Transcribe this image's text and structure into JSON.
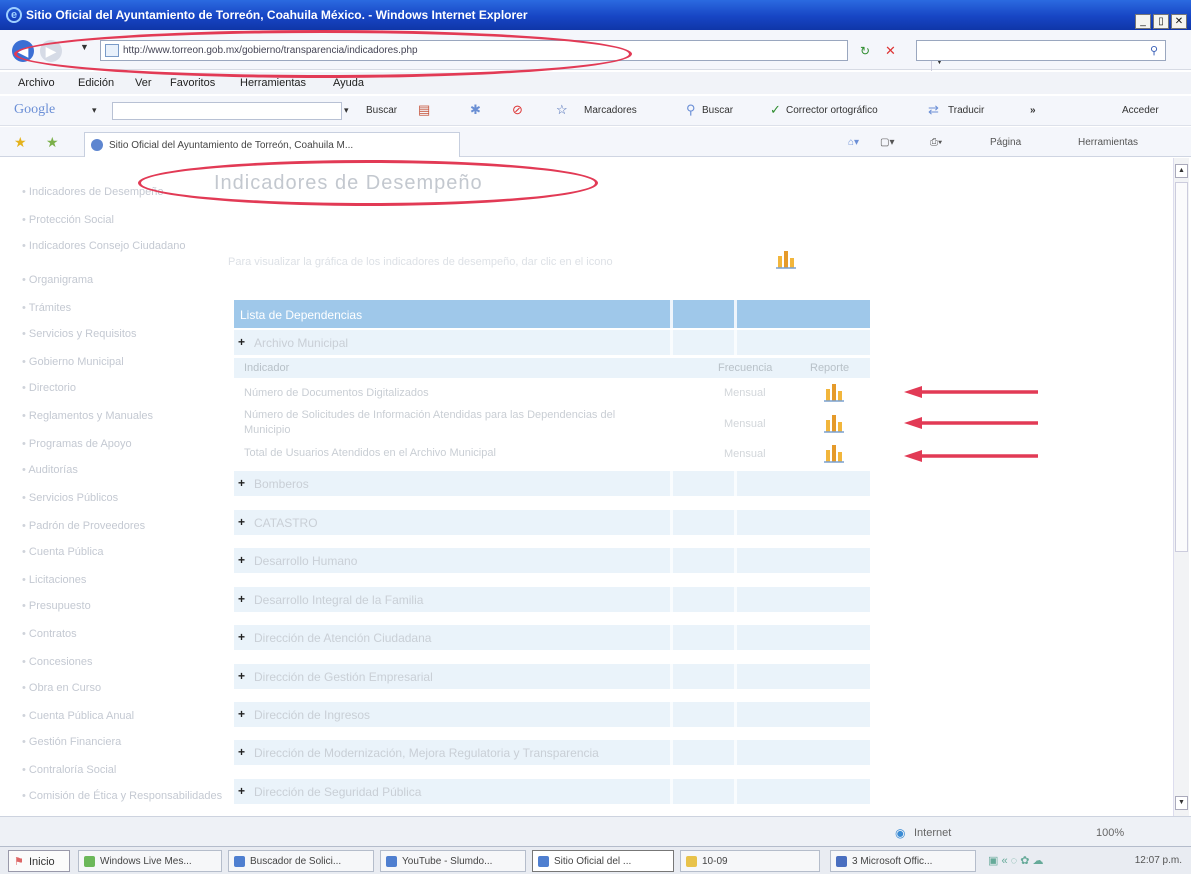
{
  "window": {
    "title": "Sitio Oficial del Ayuntamiento de Torreón, Coahuila México. - Windows Internet Explorer",
    "controls": [
      "_",
      "▯",
      "✕"
    ]
  },
  "address": {
    "url": "http://www.torreon.gob.mx/gobierno/transparencia/indicadores.php"
  },
  "menu": [
    "Archivo",
    "Edición",
    "Ver",
    "Favoritos",
    "Herramientas",
    "Ayuda"
  ],
  "google_toolbar": {
    "logo": "Google",
    "buscar": "Buscar",
    "marcadores": "Marcadores",
    "buscar2": "Buscar",
    "corrector": "Corrector ortográfico",
    "traducir": "Traducir",
    "more": "»",
    "acceder": "Acceder"
  },
  "tab": {
    "title": "Sitio Oficial del Ayuntamiento de Torreón, Coahuila M..."
  },
  "command_bar": {
    "pagina": "Página",
    "herramientas": "Herramientas"
  },
  "page": {
    "heading": "Indicadores de Desempeño",
    "intro": "Para visualizar la gráfica de los indicadores de desempeño, dar clic en el icono",
    "left_nav": [
      "Indicadores de Desempeño",
      "Protección Social",
      "Indicadores Consejo Ciudadano",
      "Organigrama",
      "Trámites",
      "Servicios y Requisitos",
      "Gobierno Municipal",
      "Directorio",
      "Reglamentos y Manuales",
      "Programas de Apoyo",
      "Auditorías",
      "Servicios Públicos",
      "Padrón de Proveedores",
      "Cuenta Pública",
      "Licitaciones",
      "Presupuesto",
      "Contratos",
      "Concesiones",
      "Obra en Curso",
      "Cuenta Pública Anual",
      "Gestión Financiera",
      "Contraloría Social",
      "Comisión de Ética y Responsabilidades"
    ],
    "list_header": "Lista de Dependencias",
    "groups": [
      "Archivo Municipal",
      "Bomberos",
      "CATASTRO",
      "Desarrollo Humano",
      "Desarrollo Integral de la Familia",
      "Dirección de Atención Ciudadana",
      "Dirección de Gestión Empresarial",
      "Dirección de Ingresos",
      "Dirección de Modernización, Mejora Regulatoria y Transparencia",
      "Dirección de Seguridad Pública"
    ],
    "sub_headers": {
      "indicador": "Indicador",
      "frecuencia": "Frecuencia",
      "reporte": "Reporte"
    },
    "indicators": [
      {
        "name": "Número de Documentos Digitalizados",
        "freq": "Mensual"
      },
      {
        "name": "Número de Solicitudes de Información Atendidas para las Dependencias del Municipio",
        "freq": "Mensual"
      },
      {
        "name": "Total de Usuarios Atendidos en el Archivo Municipal",
        "freq": "Mensual"
      }
    ]
  },
  "status": {
    "zone": "Internet",
    "zoom": "100%"
  },
  "taskbar": {
    "start": "Inicio",
    "items": [
      "Windows Live Mes...",
      "Buscador de Solici...",
      "YouTube - Slumdo...",
      "Sitio Oficial del ...",
      "10-09",
      "3 Microsoft Offic..."
    ],
    "clock": "12:07 p.m."
  },
  "colors": {
    "header_blue": "#9fc8ea",
    "row_blue": "#eaf3fa",
    "annotation_red": "#e23a55",
    "title_bar": "#1745c4"
  }
}
